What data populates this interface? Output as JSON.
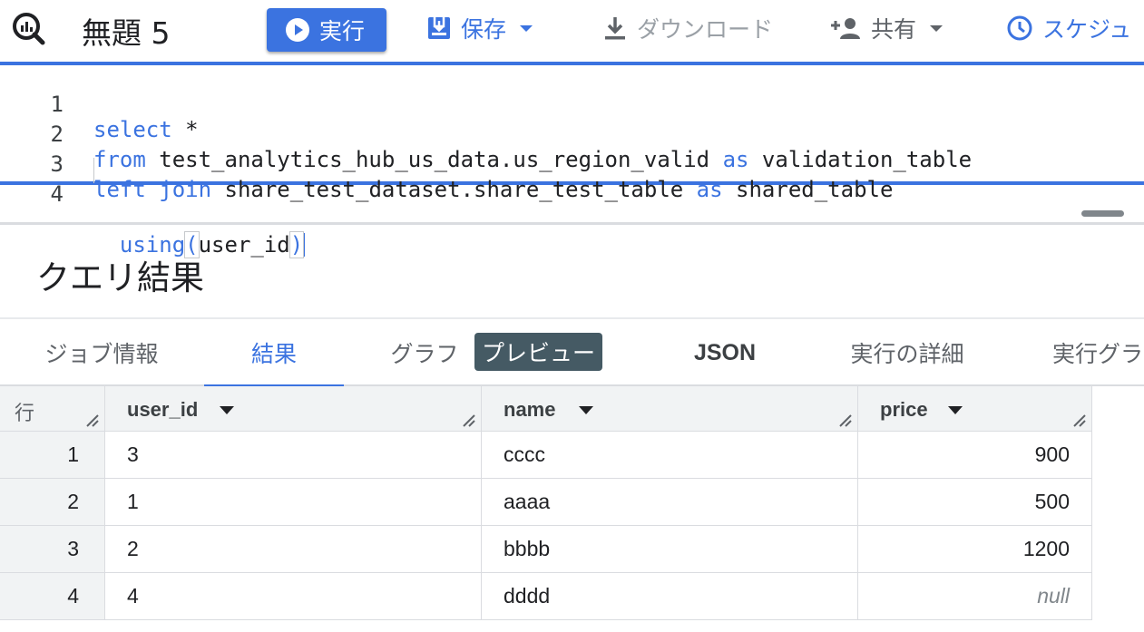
{
  "toolbar": {
    "title": "無題 5",
    "run_label": "実行",
    "save_label": "保存",
    "download_label": "ダウンロード",
    "share_label": "共有",
    "schedule_label": "スケジュ"
  },
  "editor": {
    "lines": [
      {
        "no": "1",
        "parts": [
          [
            "kw",
            "select"
          ],
          [
            "",
            " *"
          ]
        ]
      },
      {
        "no": "2",
        "parts": [
          [
            "kw",
            "from"
          ],
          [
            "",
            " test_analytics_hub_us_data.us_region_valid "
          ],
          [
            "kw",
            "as"
          ],
          [
            "",
            " validation_table"
          ]
        ]
      },
      {
        "no": "3",
        "parts": [
          [
            "kw",
            "left"
          ],
          [
            "",
            " "
          ],
          [
            "kw",
            "join"
          ],
          [
            "",
            " share_test_dataset.share_test_table "
          ],
          [
            "kw",
            "as"
          ],
          [
            "",
            " shared_table"
          ]
        ]
      },
      {
        "no": "4",
        "parts": [
          [
            "",
            "  "
          ],
          [
            "kw",
            "using"
          ],
          [
            "kwb",
            "("
          ],
          [
            "",
            "user_id"
          ],
          [
            "kwb",
            ")"
          ]
        ]
      }
    ]
  },
  "results": {
    "title": "クエリ結果",
    "tabs": [
      "ジョブ情報",
      "結果",
      "グラフ",
      "JSON",
      "実行の詳細",
      "実行グラ"
    ],
    "active_tab": "結果",
    "tooltip": "プレビュー"
  },
  "table": {
    "row_header": "行",
    "columns": [
      "user_id",
      "name",
      "price"
    ],
    "rows": [
      {
        "n": "1",
        "user_id": "3",
        "name": "cccc",
        "price": "900"
      },
      {
        "n": "2",
        "user_id": "1",
        "name": "aaaa",
        "price": "500"
      },
      {
        "n": "3",
        "user_id": "2",
        "name": "bbbb",
        "price": "1200"
      },
      {
        "n": "4",
        "user_id": "4",
        "name": "dddd",
        "price": "null"
      }
    ]
  },
  "colors": {
    "accent": "#3b73e0",
    "header_bg": "#f1f3f4",
    "tooltip_bg": "#455a64"
  }
}
